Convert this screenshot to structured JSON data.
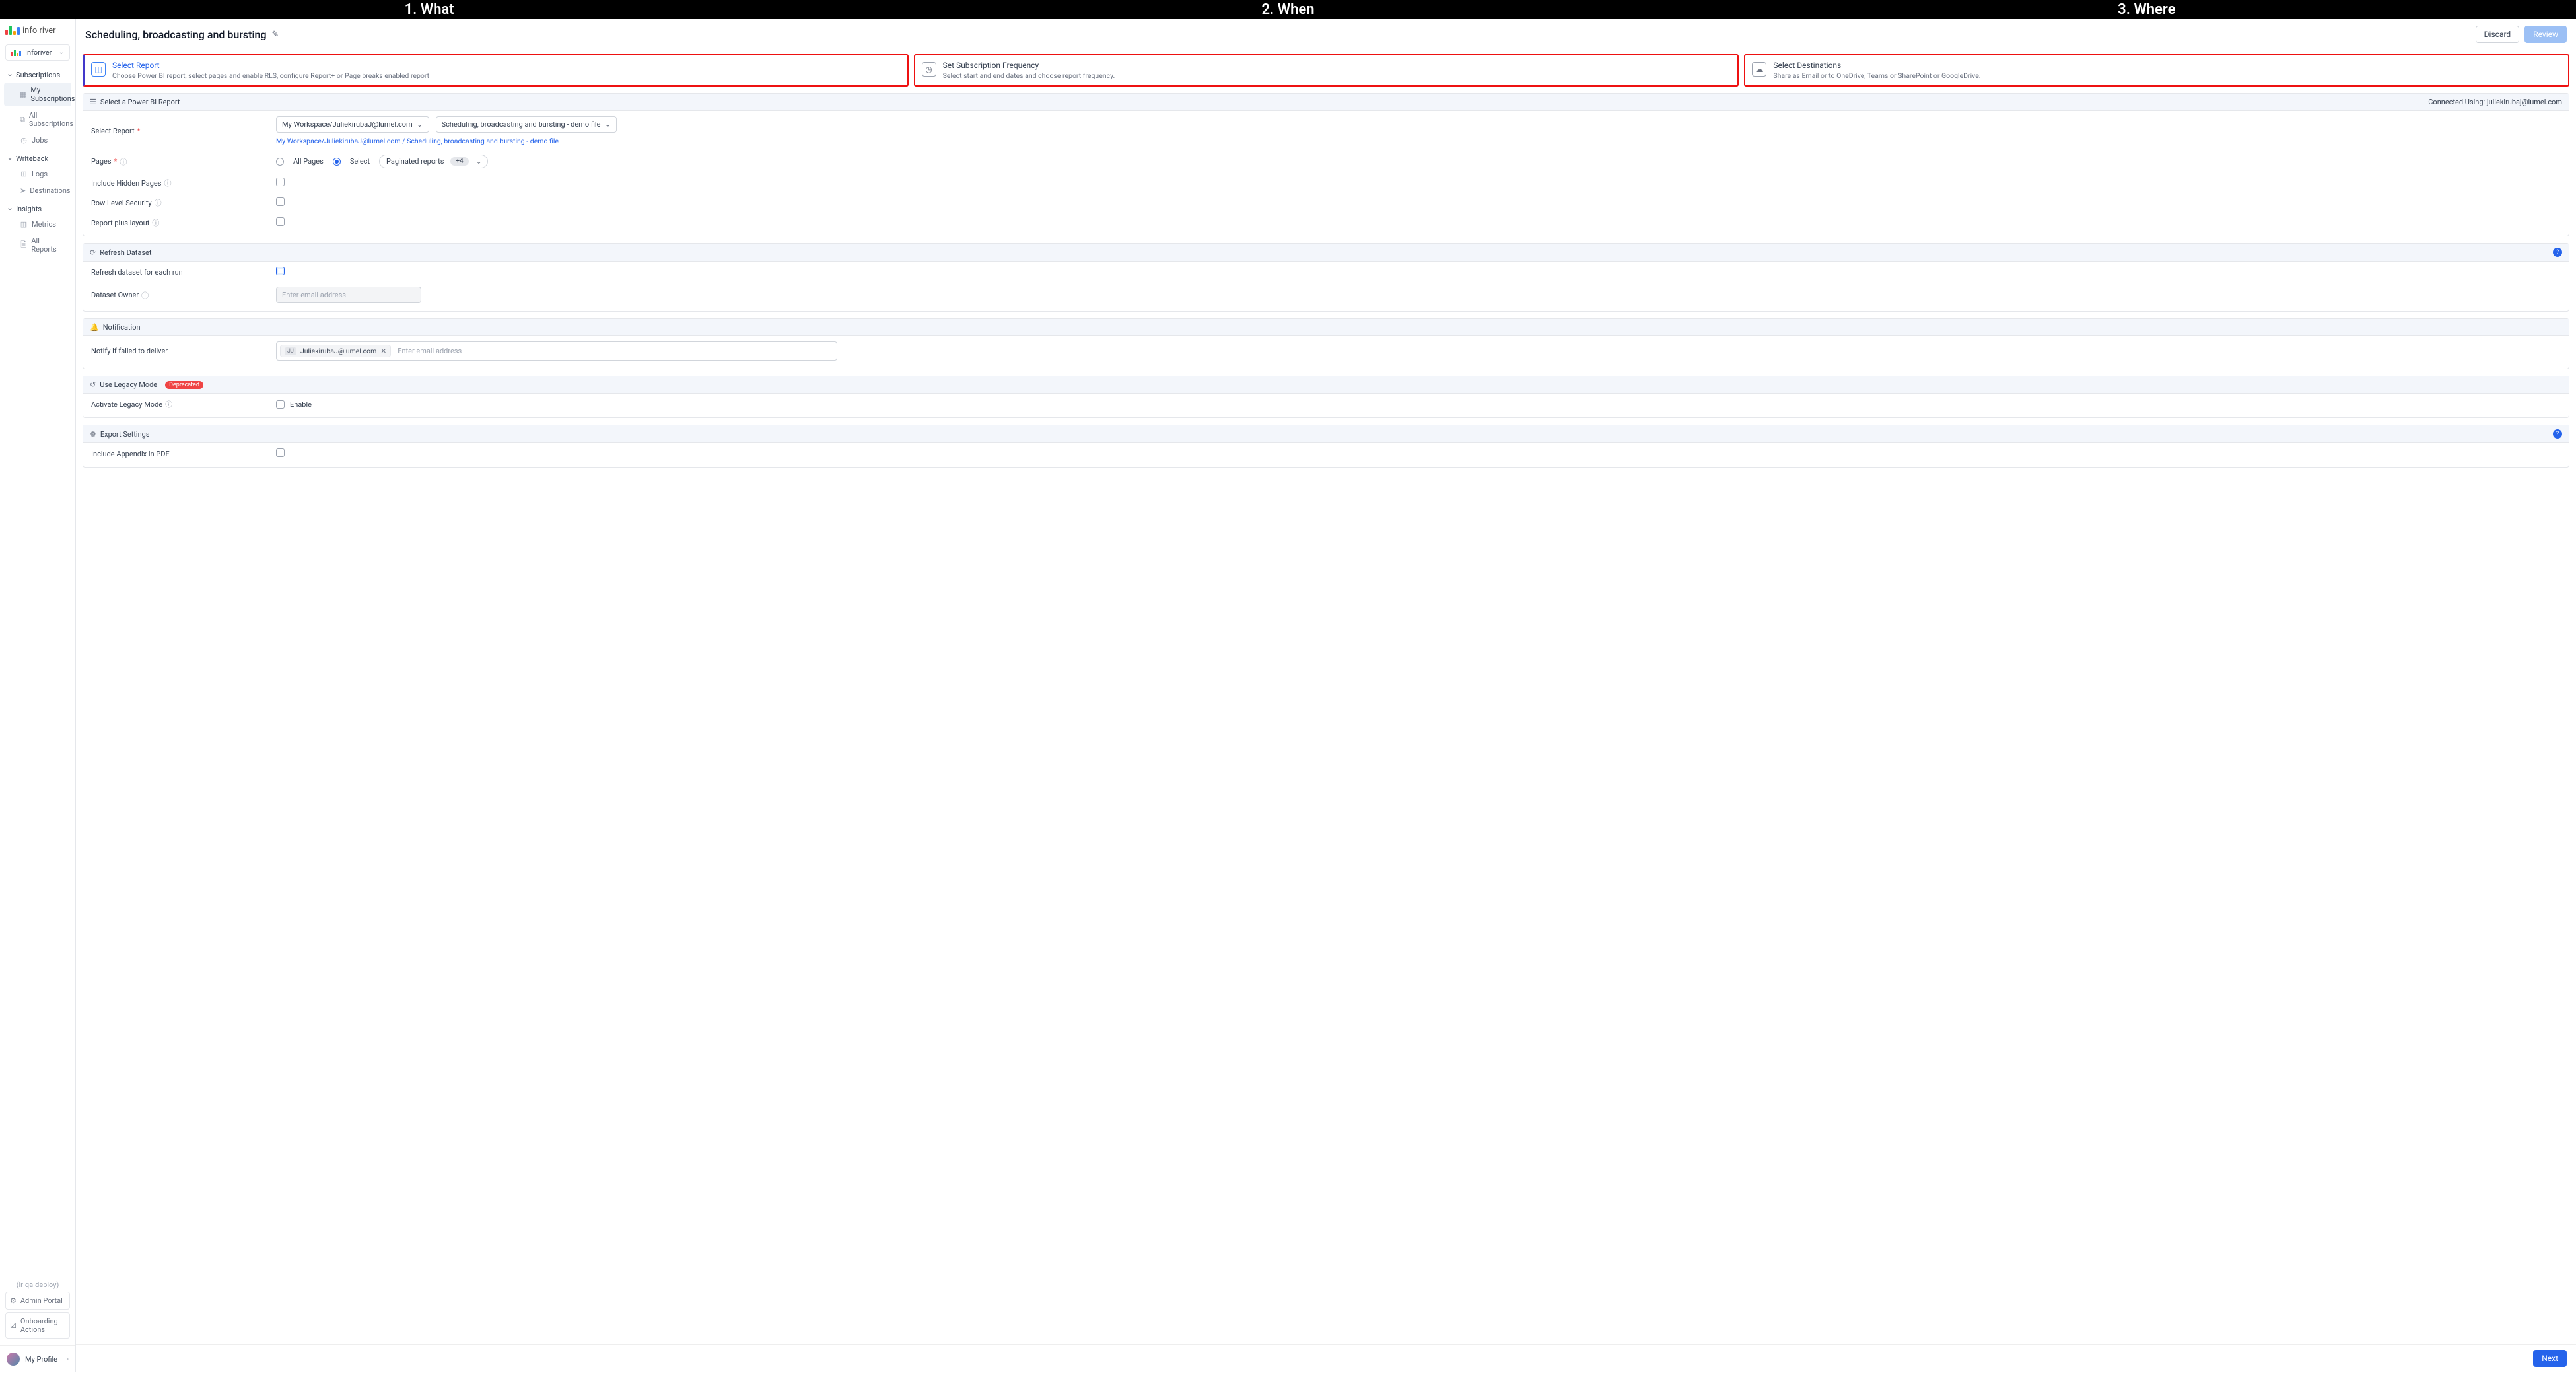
{
  "topbar": {
    "what": "1. What",
    "when": "2. When",
    "where": "3. Where"
  },
  "brand": {
    "name": "info river"
  },
  "workspace": {
    "label": "Inforiver"
  },
  "nav": {
    "subscriptions": {
      "title": "Subscriptions",
      "my": "My Subscriptions",
      "all": "All Subscriptions",
      "jobs": "Jobs"
    },
    "writeback": {
      "title": "Writeback",
      "logs": "Logs",
      "destinations": "Destinations"
    },
    "insights": {
      "title": "Insights",
      "metrics": "Metrics",
      "allreports": "All Reports"
    }
  },
  "sidebarFooter": {
    "env": "(ir-qa-deploy)",
    "admin": "Admin Portal",
    "onboarding": "Onboarding Actions",
    "profile": "My Profile"
  },
  "page": {
    "title": "Scheduling, broadcasting and bursting",
    "discard": "Discard",
    "review": "Review"
  },
  "steps": {
    "s1": {
      "title": "Select Report",
      "desc": "Choose Power BI report, select pages and enable RLS, configure Report+ or Page breaks enabled report"
    },
    "s2": {
      "title": "Set Subscription Frequency",
      "desc": "Select start and end dates and choose report frequency."
    },
    "s3": {
      "title": "Select Destinations",
      "desc": "Share as Email or to OneDrive, Teams or SharePoint or GoogleDrive."
    }
  },
  "panel1": {
    "title": "Select a Power BI Report",
    "connectedPrefix": "Connected Using: ",
    "connectedUser": "juliekirubaj@lumel.com",
    "selectReportLabel": "Select Report",
    "workspaceSelect": "My Workspace/JuliekirubaJ@lumel.com",
    "reportSelect": "Scheduling, broadcasting and bursting - demo file",
    "fullPath": "My Workspace/JuliekirubaJ@lumel.com / Scheduling, broadcasting and bursting - demo file",
    "pagesLabel": "Pages",
    "allPages": "All Pages",
    "selectOpt": "Select",
    "paginated": "Paginated reports",
    "plus4": "+4",
    "hiddenPages": "Include Hidden Pages",
    "rls": "Row Level Security",
    "reportPlus": "Report plus layout"
  },
  "panel2": {
    "title": "Refresh Dataset",
    "refreshEach": "Refresh dataset for each run",
    "ownerLabel": "Dataset Owner",
    "ownerPlaceholder": "Enter email address"
  },
  "panel3": {
    "title": "Notification",
    "notifyLabel": "Notify if failed to deliver",
    "chipInitials": "JJ",
    "chipEmail": "JuliekirubaJ@lumel.com",
    "placeholder": "Enter email address"
  },
  "panel4": {
    "title": "Use Legacy Mode",
    "deprecated": "Deprecated",
    "activateLabel": "Activate Legacy Mode",
    "enable": "Enable"
  },
  "panel5": {
    "title": "Export Settings",
    "appendix": "Include Appendix in PDF"
  },
  "footer": {
    "next": "Next"
  }
}
